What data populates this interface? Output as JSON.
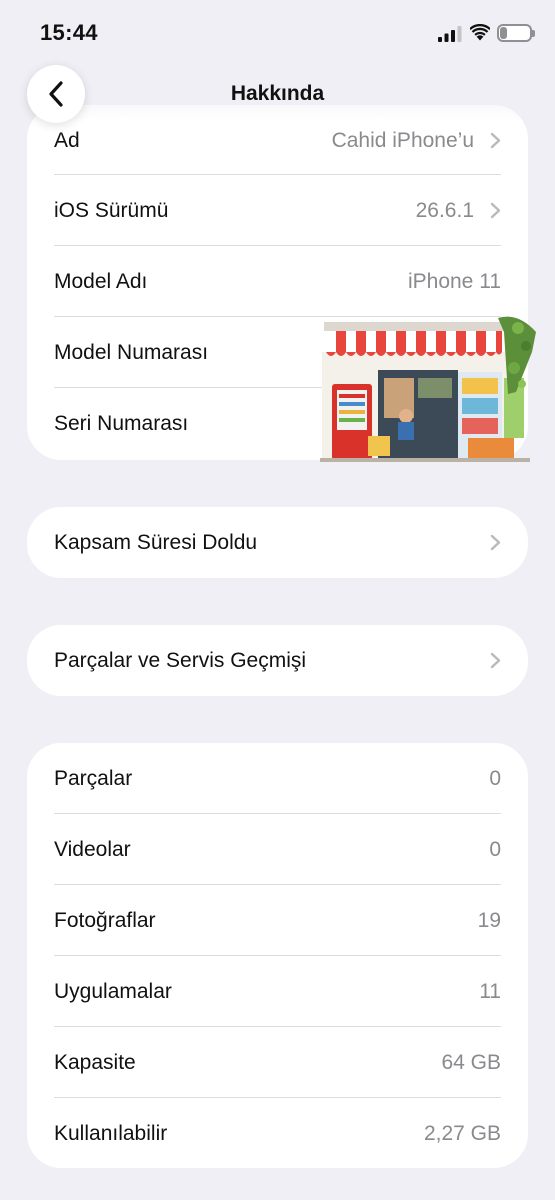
{
  "status": {
    "time": "15:44",
    "battery": "24",
    "battery_level": 0.24,
    "icons": [
      "cellular-signal-icon",
      "wifi-icon",
      "battery-icon"
    ]
  },
  "nav": {
    "title": "Hakkında",
    "back_icon": "chevron-left-icon"
  },
  "device_info": [
    {
      "label": "Ad",
      "value": "Cahid iPhone’u",
      "chevron": true
    },
    {
      "label": "iOS Sürümü",
      "value": "26.6.1",
      "chevron": true
    },
    {
      "label": "Model Adı",
      "value": "iPhone 11",
      "chevron": false
    },
    {
      "label": "Model Numarası",
      "value": "",
      "chevron": false
    },
    {
      "label": "Seri Numarası",
      "value": "",
      "chevron": false
    }
  ],
  "coverage": {
    "label": "Kapsam Süresi Doldu",
    "chevron": true
  },
  "service": {
    "label": "Parçalar ve Servis Geçmişi",
    "chevron": true
  },
  "storage": [
    {
      "label": "Parçalar",
      "value": "0"
    },
    {
      "label": "Videolar",
      "value": "0"
    },
    {
      "label": "Fotoğraflar",
      "value": "19"
    },
    {
      "label": "Uygulamalar",
      "value": "11"
    },
    {
      "label": "Kapasite",
      "value": "64 GB"
    },
    {
      "label": "Kullanılabilir",
      "value": "2,27 GB"
    }
  ],
  "colors": {
    "background": "#f0eff5",
    "card": "#ffffff",
    "secondary_text": "#8a8a8e",
    "divider": "#dcdce0"
  }
}
